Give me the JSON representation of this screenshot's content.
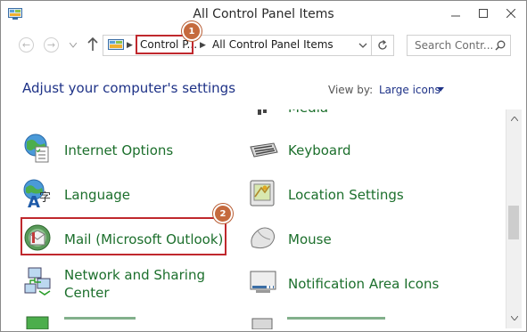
{
  "window": {
    "title": "All Control Panel Items",
    "controls": {
      "minimize": "minimize-icon",
      "maximize": "maximize-icon",
      "close": "close-icon"
    }
  },
  "nav": {
    "back_icon": "back-arrow-icon",
    "forward_icon": "forward-arrow-icon",
    "up_icon": "up-arrow-icon",
    "breadcrumbs": [
      "Control P...",
      "All Control Panel Items"
    ],
    "search_placeholder": "Search Contr...",
    "search_icon": "search-icon",
    "refresh_icon": "refresh-icon"
  },
  "annotations": {
    "badge1": "1",
    "badge2": "2",
    "highlight_color": "#c0282d",
    "badge_color": "#c56a3e"
  },
  "header": {
    "title": "Adjust your computer's settings",
    "view_by_label": "View by:",
    "view_by_value": "Large icons"
  },
  "items": {
    "media_partial": "Media",
    "internet_options": "Internet Options",
    "keyboard": "Keyboard",
    "language": "Language",
    "location_settings": "Location Settings",
    "mail": "Mail (Microsoft Outlook)",
    "mouse": "Mouse",
    "network_line1": "Network and Sharing",
    "network_line2": "Center",
    "notification_area_icons": "Notification Area Icons"
  },
  "colors": {
    "heading": "#1e3287",
    "item_text": "#1c6f2c"
  }
}
